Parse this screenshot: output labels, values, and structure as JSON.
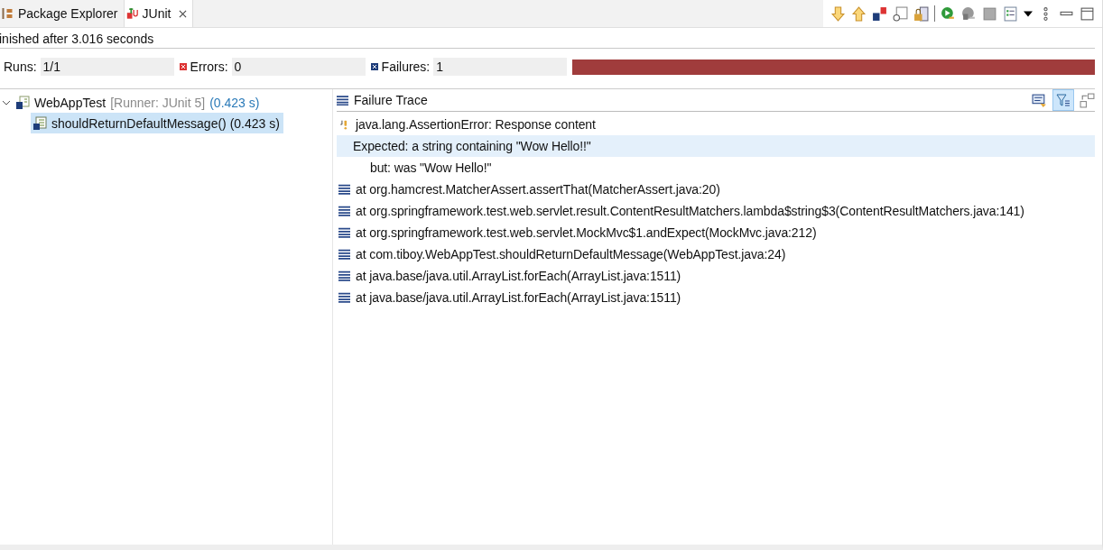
{
  "tabs": [
    {
      "label": "Package Explorer",
      "selected": false,
      "closable": false
    },
    {
      "label": "JUnit",
      "selected": true,
      "closable": true
    }
  ],
  "status": "inished after 3.016 seconds",
  "counters": {
    "runs_label": "Runs:",
    "runs": "1/1",
    "errors_label": "Errors:",
    "errors": "0",
    "failures_label": "Failures:",
    "failures": "1"
  },
  "progress": {
    "level": 1
  },
  "tree": [
    {
      "name": "WebAppTest",
      "runner": "[Runner: JUnit 5]",
      "time": "(0.423 s)",
      "expanded": true,
      "selected": false,
      "children": [
        {
          "name": "shouldReturnDefaultMessage()",
          "time": "(0.423 s)",
          "selected": true
        }
      ]
    }
  ],
  "trace": {
    "title": "Failure Trace",
    "filter_on": true,
    "lines": [
      {
        "kind": "error",
        "text": "java.lang.AssertionError: Response content",
        "selected": false
      },
      {
        "kind": "message",
        "text": "Expected: a string containing \"Wow Hello!!\"",
        "selected": true
      },
      {
        "kind": "message",
        "text": "     but: was \"Wow Hello!\"",
        "selected": false
      },
      {
        "kind": "frame",
        "text": "at org.hamcrest.MatcherAssert.assertThat(MatcherAssert.java:20)",
        "selected": false
      },
      {
        "kind": "frame",
        "text": "at org.springframework.test.web.servlet.result.ContentResultMatchers.lambda$string$3(ContentResultMatchers.java:141)",
        "selected": false
      },
      {
        "kind": "frame",
        "text": "at org.springframework.test.web.servlet.MockMvc$1.andExpect(MockMvc.java:212)",
        "selected": false
      },
      {
        "kind": "frame",
        "text": "at com.tiboy.WebAppTest.shouldReturnDefaultMessage(WebAppTest.java:24)",
        "selected": false
      },
      {
        "kind": "frame",
        "text": "at java.base/java.util.ArrayList.forEach(ArrayList.java:1511)",
        "selected": false
      },
      {
        "kind": "frame",
        "text": "at java.base/java.util.ArrayList.forEach(ArrayList.java:1511)",
        "selected": false
      }
    ]
  }
}
